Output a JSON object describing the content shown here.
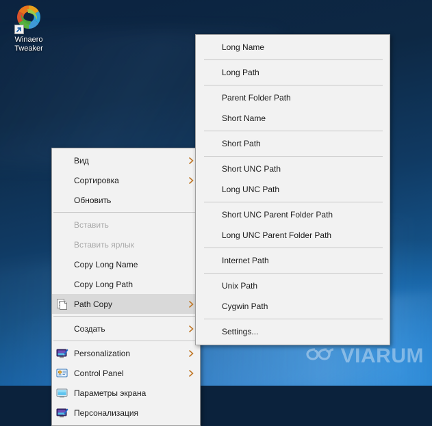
{
  "desktop": {
    "icon": {
      "name": "Winaero\nTweaker",
      "line1": "Winaero",
      "line2": "Tweaker",
      "icon_name": "winaero-tweaker-app-icon",
      "shortcut_badge": "shortcut-arrow-overlay"
    },
    "watermark": {
      "text": "VIARUM",
      "logo_name": "viarum-loop-logo"
    },
    "wallpaper_colors": {
      "top": "#0c2340",
      "bottom": "#1872bf"
    }
  },
  "context_menu": {
    "name": "desktop-context-menu",
    "background": "#f2f2f2",
    "border": "#9e9e9e",
    "highlight": "#d9d9d9",
    "chevron_color": "#c07828",
    "items": [
      {
        "label": "Вид",
        "icon": "",
        "submenu": true,
        "disabled": false,
        "selected": false,
        "sep_after": false
      },
      {
        "label": "Сортировка",
        "icon": "",
        "submenu": true,
        "disabled": false,
        "selected": false,
        "sep_after": false
      },
      {
        "label": "Обновить",
        "icon": "",
        "submenu": false,
        "disabled": false,
        "selected": false,
        "sep_after": true
      },
      {
        "label": "Вставить",
        "icon": "",
        "submenu": false,
        "disabled": true,
        "selected": false,
        "sep_after": false
      },
      {
        "label": "Вставить ярлык",
        "icon": "",
        "submenu": false,
        "disabled": true,
        "selected": false,
        "sep_after": false
      },
      {
        "label": "Copy Long Name",
        "icon": "",
        "submenu": false,
        "disabled": false,
        "selected": false,
        "sep_after": false
      },
      {
        "label": "Copy Long Path",
        "icon": "",
        "submenu": false,
        "disabled": false,
        "selected": false,
        "sep_after": false
      },
      {
        "label": "Path Copy",
        "icon": "copy-document-icon",
        "submenu": true,
        "disabled": false,
        "selected": true,
        "sep_after": true
      },
      {
        "label": "Создать",
        "icon": "",
        "submenu": true,
        "disabled": false,
        "selected": false,
        "sep_after": true
      },
      {
        "label": "Personalization",
        "icon": "personalization-monitor-icon",
        "submenu": true,
        "disabled": false,
        "selected": false,
        "sep_after": false
      },
      {
        "label": "Control Panel",
        "icon": "control-panel-icon",
        "submenu": true,
        "disabled": false,
        "selected": false,
        "sep_after": false
      },
      {
        "label": "Параметры экрана",
        "icon": "display-settings-monitor-icon",
        "submenu": false,
        "disabled": false,
        "selected": false,
        "sep_after": false
      },
      {
        "label": "Персонализация",
        "icon": "personalization-monitor-icon",
        "submenu": false,
        "disabled": false,
        "selected": false,
        "sep_after": false
      }
    ]
  },
  "path_copy_submenu": {
    "name": "path-copy-submenu",
    "items": [
      {
        "label": "Long Name",
        "sep_after": true
      },
      {
        "label": "Long Path",
        "sep_after": true
      },
      {
        "label": "Parent Folder Path",
        "sep_after": false
      },
      {
        "label": "Short Name",
        "sep_after": true
      },
      {
        "label": "Short Path",
        "sep_after": true
      },
      {
        "label": "Short UNC Path",
        "sep_after": false
      },
      {
        "label": "Long UNC Path",
        "sep_after": true
      },
      {
        "label": "Short UNC Parent Folder Path",
        "sep_after": false
      },
      {
        "label": "Long UNC Parent Folder Path",
        "sep_after": true
      },
      {
        "label": "Internet Path",
        "sep_after": true
      },
      {
        "label": "Unix Path",
        "sep_after": false
      },
      {
        "label": "Cygwin Path",
        "sep_after": true
      },
      {
        "label": "Settings...",
        "sep_after": false
      }
    ]
  }
}
